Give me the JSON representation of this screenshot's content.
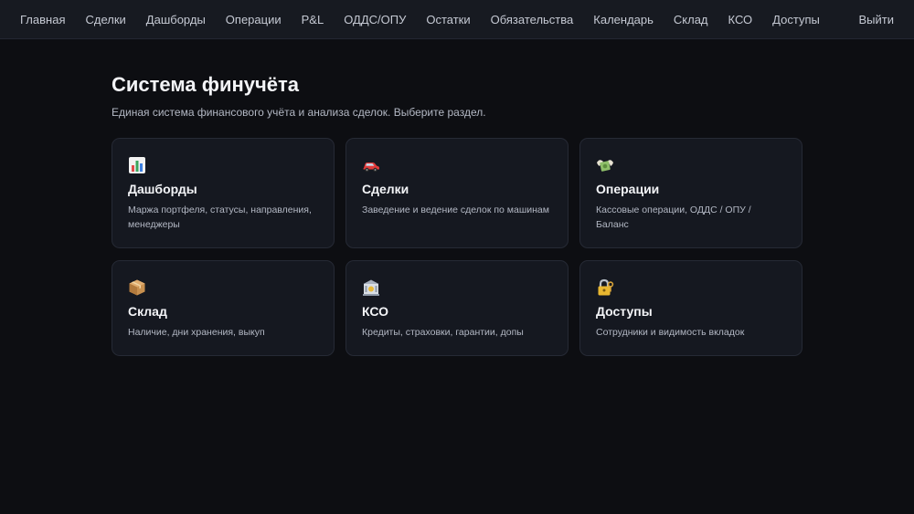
{
  "nav": {
    "items": [
      {
        "label": "Главная",
        "name": "nav-home"
      },
      {
        "label": "Сделки",
        "name": "nav-deals"
      },
      {
        "label": "Дашборды",
        "name": "nav-dashboards"
      },
      {
        "label": "Операции",
        "name": "nav-operations"
      },
      {
        "label": "P&L",
        "name": "nav-pnl"
      },
      {
        "label": "ОДДС/ОПУ",
        "name": "nav-odds-opu"
      },
      {
        "label": "Остатки",
        "name": "nav-balances"
      },
      {
        "label": "Обязательства",
        "name": "nav-liabilities"
      },
      {
        "label": "Календарь",
        "name": "nav-calendar"
      },
      {
        "label": "Склад",
        "name": "nav-warehouse"
      },
      {
        "label": "КСО",
        "name": "nav-kso"
      },
      {
        "label": "Доступы",
        "name": "nav-access"
      }
    ],
    "logout": "Выйти"
  },
  "main": {
    "title": "Система финучёта",
    "subtitle": "Единая система финансового учёта и анализа сделок. Выберите раздел."
  },
  "cards": [
    {
      "icon": "bar-chart-icon",
      "title": "Дашборды",
      "desc": "Маржа портфеля, статусы, направления, менеджеры"
    },
    {
      "icon": "car-icon",
      "title": "Сделки",
      "desc": "Заведение и ведение сделок по машинам"
    },
    {
      "icon": "money-wings-icon",
      "title": "Операции",
      "desc": "Кассовые операции, ОДДС / ОПУ / Баланс"
    },
    {
      "icon": "package-icon",
      "title": "Склад",
      "desc": "Наличие, дни хранения, выкуп"
    },
    {
      "icon": "bank-icon",
      "title": "КСО",
      "desc": "Кредиты, страховки, гарантии, допы"
    },
    {
      "icon": "lock-key-icon",
      "title": "Доступы",
      "desc": "Сотрудники и видимость вкладок"
    }
  ]
}
